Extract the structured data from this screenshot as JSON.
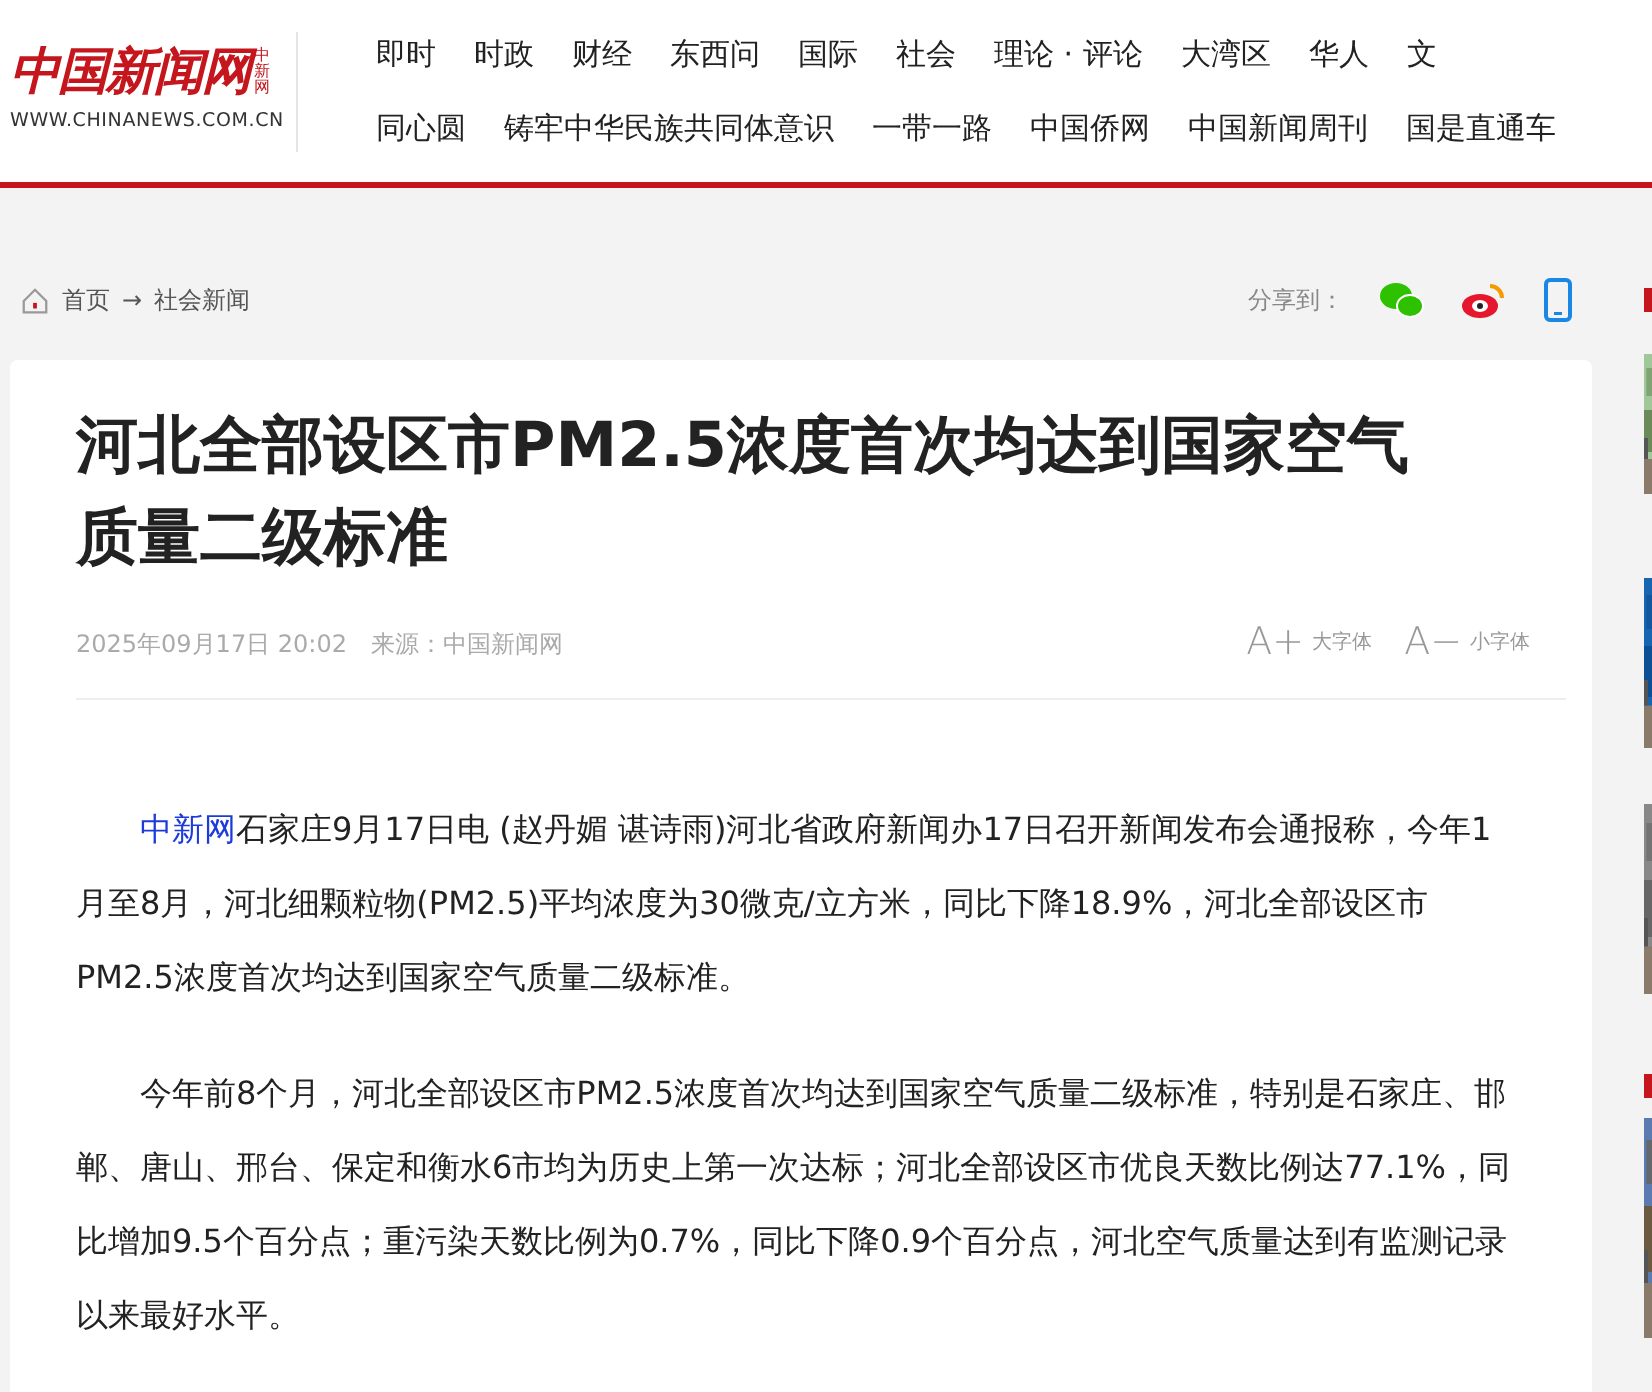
{
  "logo": {
    "name": "中国新闻网",
    "side": "中新网",
    "url": "WWW.CHINANEWS.COM.CN"
  },
  "nav_rows": [
    [
      "即时",
      "时政",
      "财经",
      "东西问",
      "国际",
      "社会",
      "理论 · 评论",
      "大湾区",
      "华人",
      "文"
    ],
    [
      "同心圆",
      "铸牢中华民族共同体意识",
      "一带一路",
      "中国侨网",
      "中国新闻周刊",
      "国是直通车"
    ]
  ],
  "breadcrumb": {
    "home": "首页",
    "separator": "→",
    "current": "社会新闻"
  },
  "share": {
    "label": "分享到："
  },
  "article": {
    "title": "河北全部设区市PM2.5浓度首次均达到国家空气质量二级标准",
    "date": "2025年09月17日 20:02",
    "source": "来源：中国新闻网",
    "font_buttons": [
      {
        "glyph": "A+",
        "label": "大字体"
      },
      {
        "glyph": "A−",
        "label": "小字体"
      }
    ],
    "paragraphs": [
      {
        "link": "中新网",
        "text": "石家庄9月17日电 (赵丹媚 谌诗雨)河北省政府新闻办17日召开新闻发布会通报称，今年1月至8月，河北细颗粒物(PM2.5)平均浓度为30微克/立方米，同比下降18.9%，河北全部设区市PM2.5浓度首次均达到国家空气质量二级标准。"
      },
      {
        "text": "今年前8个月，河北全部设区市PM2.5浓度首次均达到国家空气质量二级标准，特别是石家庄、邯郸、唐山、邢台、保定和衡水6市均为历史上第一次达标；河北全部设区市优良天数比例达77.1%，同比增加9.5个百分点；重污染天数比例为0.7%，同比下降0.9个百分点，河北空气质量达到有监测记录以来最好水平。"
      }
    ]
  }
}
